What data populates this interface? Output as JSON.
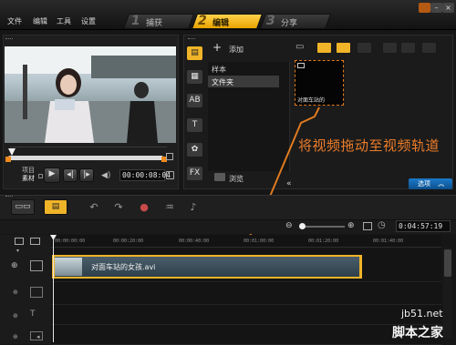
{
  "menu": [
    "文件",
    "编辑",
    "工具",
    "设置"
  ],
  "steps": [
    {
      "num": "1",
      "label": "捕获"
    },
    {
      "num": "2",
      "label": "编辑"
    },
    {
      "num": "3",
      "label": "分享"
    }
  ],
  "preview": {
    "project_label": "项目",
    "clip_label": "素材",
    "timecode": "00:00:08:04"
  },
  "library": {
    "add_label": "添加",
    "folders": [
      "样本",
      "文件夹"
    ],
    "selected_folder": "文件夹",
    "browse_label": "浏览",
    "thumbnail_caption": "对面车站的",
    "options_label": "选项"
  },
  "annotation": {
    "hint_text": "将视频拖动至视频轨道",
    "hint_color": "#ee7d2a"
  },
  "timeline": {
    "timecode": "0:04:57:19",
    "ruler_ticks": [
      "00:00:00:00",
      "00:00:20:00",
      "00:00:40:00",
      "00:01:00:00",
      "00:01:20:00",
      "00:01:40:00"
    ],
    "clip_name": "对面车站的女孩.avi"
  },
  "watermark": {
    "line1": "jb51.net",
    "line2": "脚本之家"
  },
  "colors": {
    "accent": "#f0b429",
    "arrow": "#e07a1f",
    "options_blue": "#1c79c9"
  }
}
